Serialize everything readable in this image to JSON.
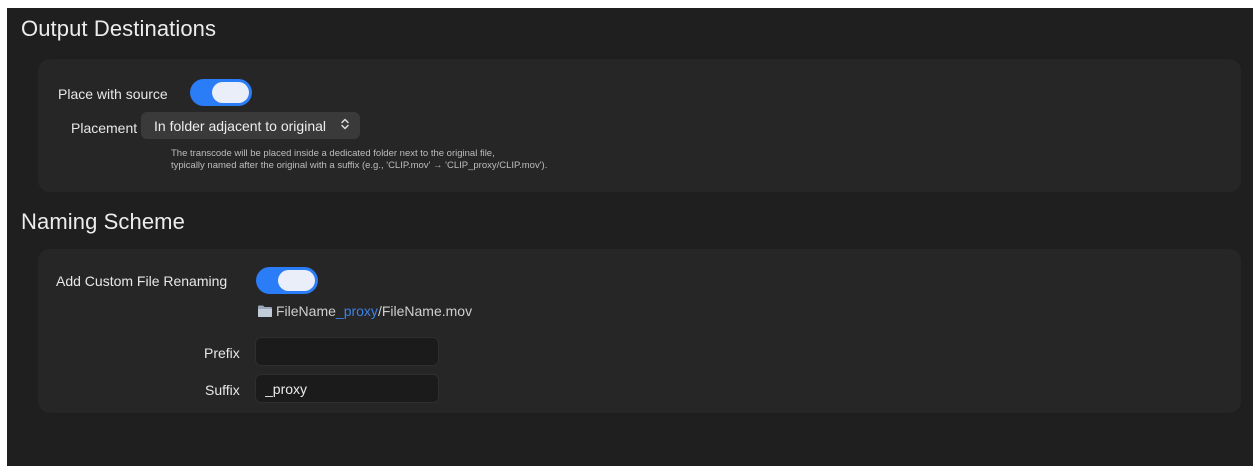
{
  "output_destinations": {
    "title": "Output Destinations",
    "place_with_source_label": "Place with source",
    "place_with_source_on": true,
    "placement_label": "Placement",
    "placement_value": "In folder adjacent to original",
    "chevron_icon": "chevron-up-down-icon",
    "description_line1": "The transcode will be placed inside a dedicated folder next to the original file,",
    "description_line2": "typically named after the original with a suffix (e.g., 'CLIP.mov' → 'CLIP_proxy/CLIP.mov')."
  },
  "naming_scheme": {
    "title": "Naming Scheme",
    "custom_renaming_label": "Add Custom File Renaming",
    "custom_renaming_on": true,
    "preview": {
      "icon": "folder-icon",
      "base": "FileName",
      "suffix": "_proxy",
      "rest": "/FileName.mov"
    },
    "prefix_label": "Prefix",
    "prefix_value": "",
    "suffix_label": "Suffix",
    "suffix_value": "_proxy"
  },
  "colors": {
    "accent": "#2a7cf7",
    "highlight": "#3b82e6",
    "background": "#1f1f1f",
    "panel": "#262626"
  }
}
